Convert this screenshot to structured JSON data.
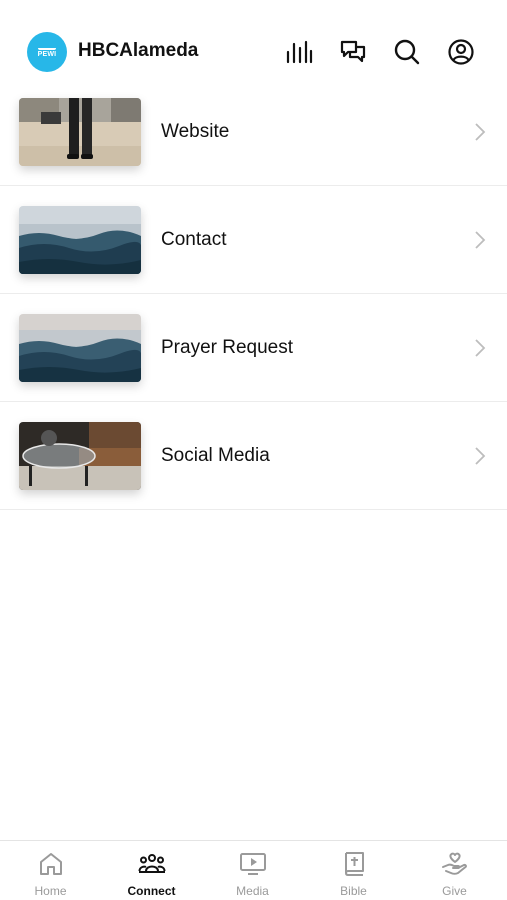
{
  "header": {
    "app_name": "HBCAlameda",
    "logo_text": "PEWI",
    "icons": [
      "audio-bars-icon",
      "chat-icon",
      "search-icon",
      "account-icon"
    ]
  },
  "connect_items": [
    {
      "label": "Website",
      "thumbnail": "person-on-beach-photo"
    },
    {
      "label": "Contact",
      "thumbnail": "ocean-wave-photo"
    },
    {
      "label": "Prayer Request",
      "thumbnail": "ocean-wave-photo"
    },
    {
      "label": "Social Media",
      "thumbnail": "glass-table-photo"
    }
  ],
  "tabs": [
    {
      "label": "Home",
      "icon": "home-icon",
      "active": false
    },
    {
      "label": "Connect",
      "icon": "people-icon",
      "active": true
    },
    {
      "label": "Media",
      "icon": "tv-play-icon",
      "active": false
    },
    {
      "label": "Bible",
      "icon": "bible-icon",
      "active": false
    },
    {
      "label": "Give",
      "icon": "hand-heart-icon",
      "active": false
    }
  ],
  "colors": {
    "brand": "#27b7e8",
    "text": "#111111",
    "inactive": "#9a9a9a",
    "divider": "#ececec"
  }
}
